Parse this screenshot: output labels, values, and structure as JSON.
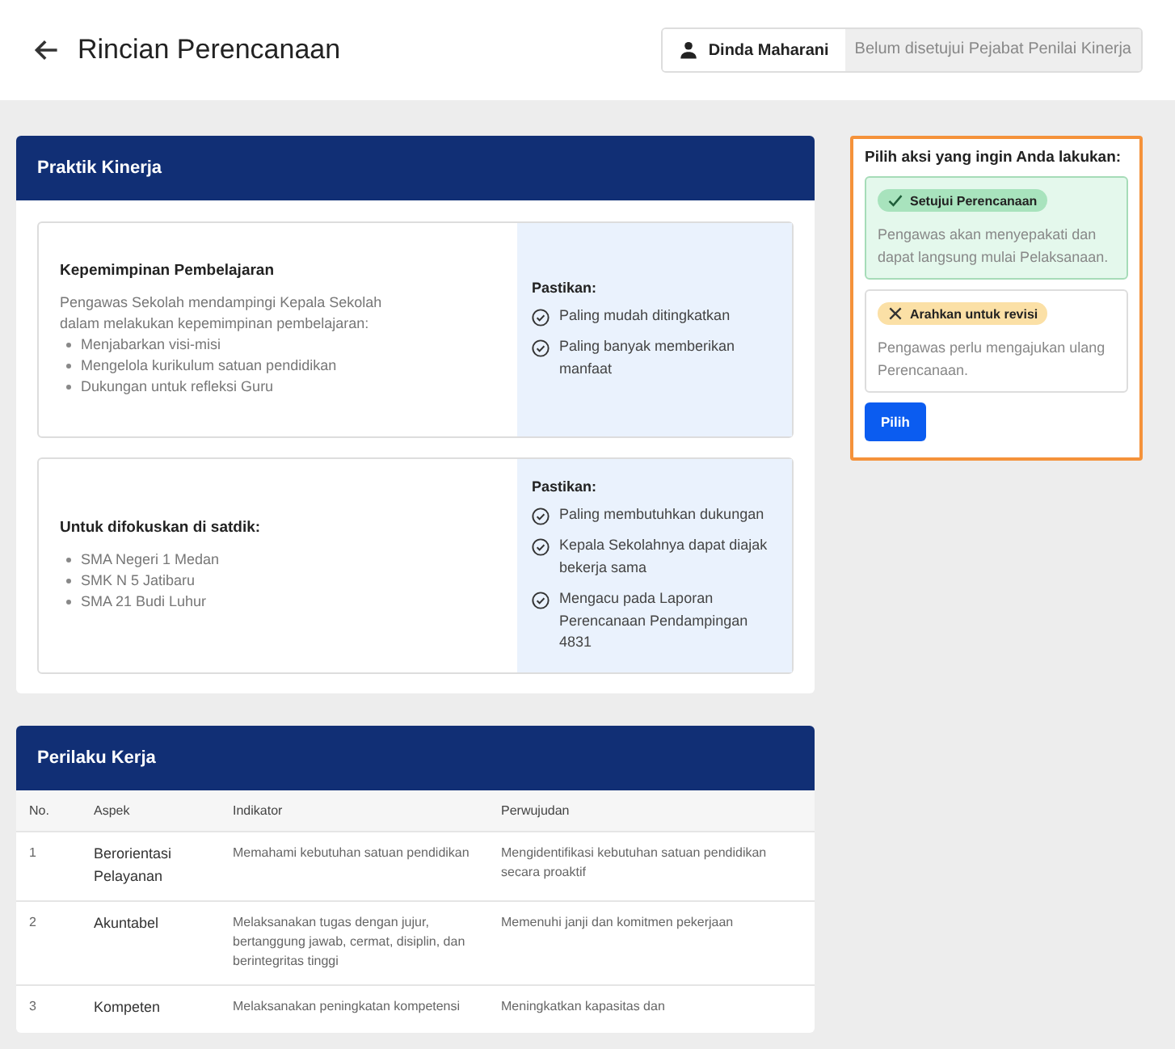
{
  "header": {
    "title": "Rincian Perencanaan",
    "user": "Dinda Maharani",
    "status": "Belum disetujui Pejabat Penilai Kinerja"
  },
  "praktik": {
    "title": "Praktik Kinerja",
    "blocks": [
      {
        "heading": "Kepemimpinan Pembelajaran",
        "description": "Pengawas Sekolah mendampingi Kepala Sekolah dalam melakukan kepemimpinan pembelajaran:",
        "bullets": [
          "Menjabarkan visi-misi",
          "Mengelola kurikulum satuan pendidikan",
          "Dukungan untuk refleksi Guru"
        ],
        "check_title": "Pastikan:",
        "checks": [
          "Paling mudah ditingkatkan",
          "Paling banyak memberikan manfaat"
        ]
      },
      {
        "heading": "Untuk difokuskan di satdik:",
        "bullets": [
          "SMA Negeri 1 Medan",
          "SMK N 5 Jatibaru",
          "SMA 21 Budi Luhur"
        ],
        "check_title": "Pastikan:",
        "checks": [
          "Paling membutuhkan dukungan",
          "Kepala Sekolahnya dapat diajak bekerja sama",
          "Mengacu pada Laporan Perencanaan Pendampingan 4831"
        ]
      }
    ]
  },
  "perilaku": {
    "title": "Perilaku Kerja",
    "columns": [
      "No.",
      "Aspek",
      "Indikator",
      "Perwujudan"
    ],
    "rows": [
      [
        "1",
        "Berorientasi Pelayanan",
        "Memahami kebutuhan satuan pendidikan",
        "Mengidentifikasi kebutuhan satuan pendidikan secara proaktif"
      ],
      [
        "2",
        "Akuntabel",
        "Melaksanakan tugas dengan jujur, bertanggung jawab, cermat, disiplin, dan berintegritas tinggi",
        "Memenuhi janji dan komitmen pekerjaan"
      ],
      [
        "3",
        "Kompeten",
        "Melaksanakan peningkatan kompetensi",
        "Meningkatkan kapasitas dan"
      ]
    ]
  },
  "action": {
    "prompt": "Pilih aksi yang ingin Anda lakukan:",
    "options": [
      {
        "kind": "approve",
        "label": "Setujui Perencanaan",
        "description": "Pengawas akan menyepakati dan dapat langsung mulai Pelaksanaan.",
        "selected": true
      },
      {
        "kind": "revise",
        "label": "Arahkan untuk revisi",
        "description": "Pengawas perlu mengajukan ulang Perencanaan.",
        "selected": false
      }
    ],
    "button": "Pilih"
  }
}
